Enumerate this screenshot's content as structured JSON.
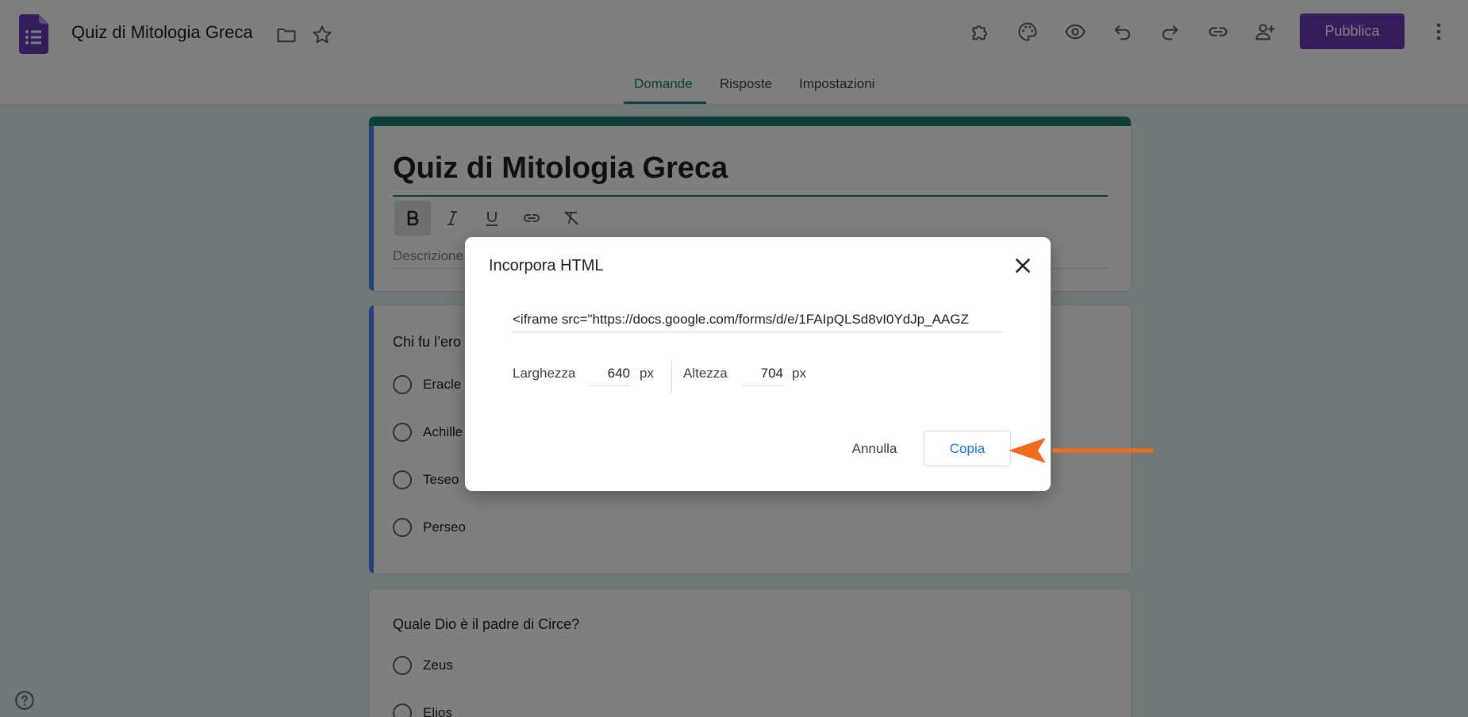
{
  "header": {
    "doc_title": "Quiz di Mitologia Greca",
    "publish_label": "Pubblica",
    "icons": [
      "addons-icon",
      "palette-icon",
      "preview-icon",
      "undo-icon",
      "redo-icon",
      "link-icon",
      "add-collaborator-icon",
      "more-vert-icon"
    ]
  },
  "tabs": [
    "Domande",
    "Risposte",
    "Impostazioni"
  ],
  "active_tab": "Domande",
  "title_card": {
    "title": "Quiz di Mitologia Greca",
    "description_placeholder": "Descrizione"
  },
  "questions": [
    {
      "text": "Chi fu l’ero",
      "options": [
        "Eracle",
        "Achille",
        "Teseo",
        "Perseo"
      ]
    },
    {
      "text": "Quale Dio è il padre di Circe?",
      "options": [
        "Zeus",
        "Elios"
      ]
    }
  ],
  "dialog": {
    "title": "Incorpora HTML",
    "embed_code": "<iframe src=\"https://docs.google.com/forms/d/e/1FAIpQLSd8vI0YdJp_AAGZ",
    "width_label": "Larghezza",
    "width_value": "640",
    "height_label": "Altezza",
    "height_value": "704",
    "unit": "px",
    "cancel_label": "Annulla",
    "copy_label": "Copia"
  },
  "colors": {
    "accent": "#1c7c72",
    "publish": "#6a3bb8",
    "copy_text": "#1a73e8",
    "annotation_arrow": "#f26b1d"
  }
}
